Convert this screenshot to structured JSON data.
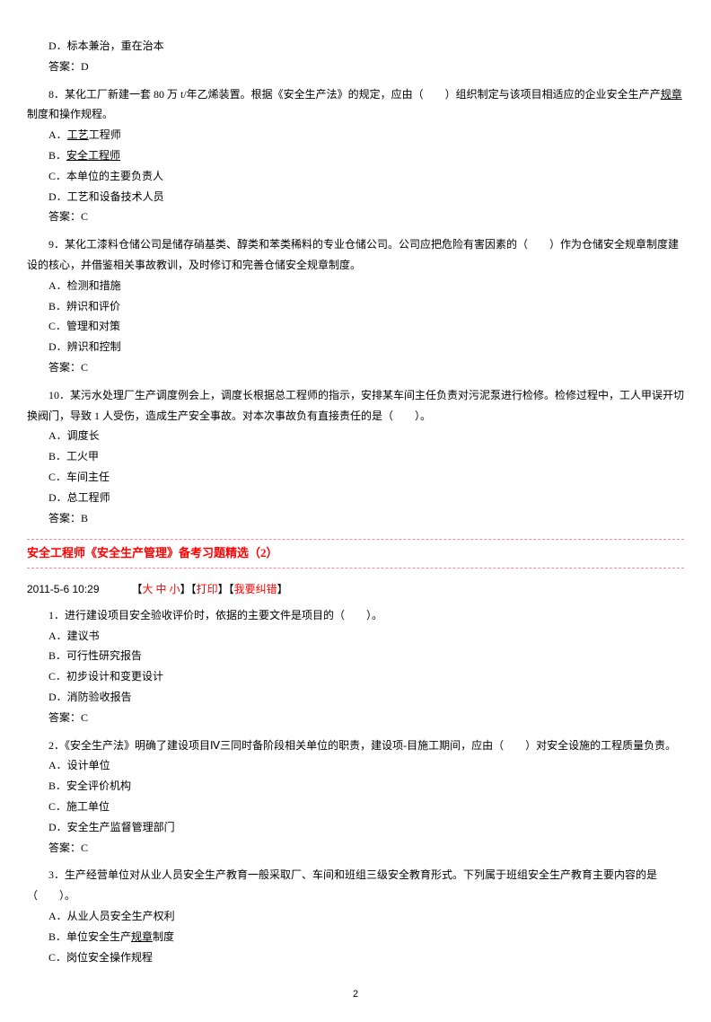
{
  "top": {
    "optionD": "D．标本兼治，重在治本",
    "answer": "答案：D"
  },
  "q8": {
    "text": "8．某化工厂新建一套 80 万 t/年乙烯装置。根据《安全生产法》的规定，应由（　　）组织制定与该项目相适应的企业安全生产",
    "text2_pre": "规章",
    "text2_post": "制度和操作规程。",
    "optA_pre": "A．",
    "optA_u": "工艺",
    "optA_post": "工程师",
    "optB_pre": "B．",
    "optB_u": "安全工程师",
    "optC": "C．本单位的主要负责人",
    "optD": "D．工艺和设备技术人员",
    "answer": "答案：C"
  },
  "q9": {
    "text": "9．某化工漆料仓储公司是储存硝基类、醇类和苯类稀料的专业仓储公司。公司应把危险有害因素的（　　）作为仓储安全规章制度建设的核心，并借鉴相关事故教训，及时修订和完善仓储安全规章制度。",
    "optA": "A．检测和措施",
    "optB": "B．辨识和评价",
    "optC": "C．管理和对策",
    "optD": "D．辨识和控制",
    "answer": "答案：C"
  },
  "q10": {
    "text": "10．某污水处理厂生产调度例会上，调度长根据总工程师的指示，安排某车间主任负责对污泥泵进行检修。检修过程中，工人甲误开切换阀门，导致 1 人受伤，造成生产安全事故。对本次事故负有直接责任的是（　　）。",
    "optA": "A．调度长",
    "optB": "B．工火甲",
    "optC": "C．车间主任",
    "optD": "D．总工程师",
    "answer": "答案：B"
  },
  "section2": {
    "title": "安全工程师《安全生产管理》备考习题精选（2）",
    "date": "2011-5-6 10:29",
    "size_pre": "【",
    "size_da": "大 ",
    "size_zhong": "中 ",
    "size_xiao": "小",
    "size_post": "】【",
    "print": "打印",
    "mid": "】【",
    "correct": "我要纠错",
    "end": "】"
  },
  "s2q1": {
    "text": "1．进行建设项目安全验收评价时，依据的主要文件是项目的（　　）。",
    "optA": "A．建议书",
    "optB": "B．可行性研究报告",
    "optC": "C．初步设计和变更设计",
    "optD": "D．消防验收报告",
    "answer": "答案：C"
  },
  "s2q2": {
    "text": "2．《安全生产法》明确了建设项目Ⅳ三同时备阶段相关单位的职责，建设项-目施工期间，应由（　　）对安全设施的工程质量负责。",
    "optA": "A．设计单位",
    "optB": "B．安全评价机构",
    "optC": "C．施工单位",
    "optD": "D．安全生产监督管理部门",
    "answer": "答案：C"
  },
  "s2q3": {
    "text": "3．生产经营单位对从业人员安全生产教育一般采取厂、车间和班组三级安全教育形式。下列属于班组安全生产教育主要内容的是（　　）。",
    "optA": "A．从业人员安全生产权利",
    "optB_pre": "B．单位安全生产",
    "optB_u": "规章",
    "optB_post": "制度",
    "optC": "C．岗位安全操作规程"
  },
  "pageNum": "2"
}
